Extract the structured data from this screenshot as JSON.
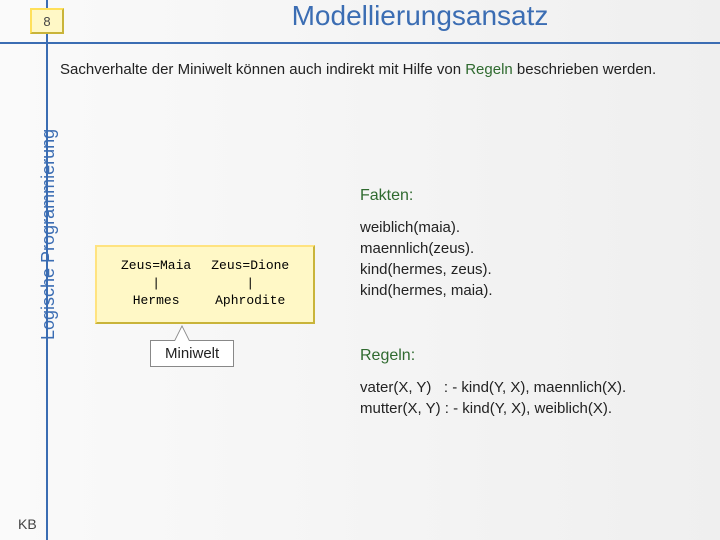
{
  "slide": {
    "number": "8",
    "title": "Modellierungsansatz",
    "footer": "KB"
  },
  "sidebar": {
    "label": "Logische Programmierung"
  },
  "intro": {
    "before": "Sachverhalte der Miniwelt können auch indirekt mit Hilfe von ",
    "keyword": "Regeln",
    "after": " beschrieben werden."
  },
  "tree": {
    "row1a": "Zeus=Maia",
    "row1b": "Zeus=Dione",
    "row2a": "|",
    "row2b": "|",
    "row3a": "Hermes",
    "row3b": "Aphrodite"
  },
  "callout": {
    "label": "Miniwelt"
  },
  "facts": {
    "heading": "Fakten:",
    "l1": "weiblich(maia).",
    "l2": "maennlich(zeus).",
    "l3": "kind(hermes, zeus).",
    "l4": "kind(hermes, maia)."
  },
  "rules": {
    "heading": "Regeln:",
    "l1": "vater(X, Y)   : - kind(Y, X), maennlich(X).",
    "l2": "mutter(X, Y) : - kind(Y, X), weiblich(X)."
  }
}
